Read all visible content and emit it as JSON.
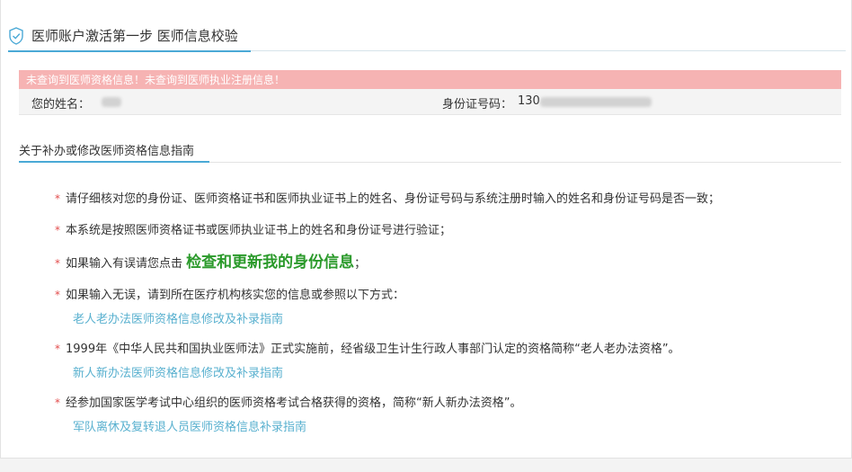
{
  "header": {
    "title": "医师账户激活第一步 医师信息校验"
  },
  "alert": {
    "message": "未查询到医师资格信息！未查询到医师执业注册信息！"
  },
  "identity": {
    "name_label": "您的姓名：",
    "id_label": "身份证号码：",
    "id_prefix": "130"
  },
  "section": {
    "title": "关于补办或修改医师资格信息指南"
  },
  "bullets": [
    {
      "text": "请仔细核对您的身份证、医师资格证书和医师执业证书上的姓名、身份证号码与系统注册时输入的姓名和身份证号码是否一致；"
    },
    {
      "text": "本系统是按照医师资格证书或医师执业证书上的姓名和身份证号进行验证；"
    },
    {
      "prefix": "如果输入有误请您点击",
      "highlight": "检查和更新我的身份信息",
      "suffix": "；"
    },
    {
      "text": "如果输入无误，请到所在医疗机构核实您的信息或参照以下方式："
    },
    {
      "text": "1999年《中华人民共和国执业医师法》正式实施前，经省级卫生计生行政人事部门认定的资格简称“老人老办法资格”。"
    },
    {
      "text": "经参加国家医学考试中心组织的医师资格考试合格获得的资格，简称“新人新办法资格”。"
    }
  ],
  "links": [
    "老人老办法医师资格信息修改及补录指南",
    "新人新办法医师资格信息修改及补录指南",
    "军队离休及复转退人员医师资格信息补录指南"
  ],
  "colors": {
    "accent": "#4aa9d6",
    "alert_bg": "#f6b3b3",
    "link": "#58b0cf",
    "highlight": "#2b9a2b",
    "star": "#e24b4b"
  }
}
